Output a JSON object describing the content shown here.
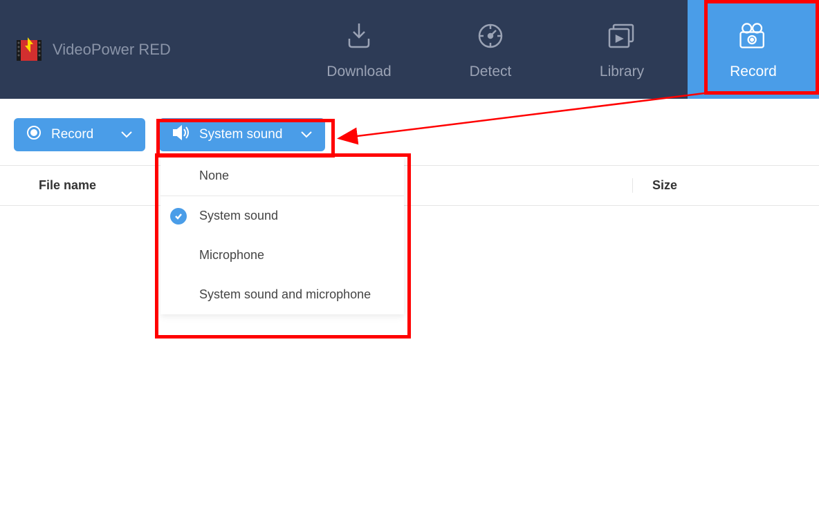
{
  "app": {
    "title": "VideoPower RED"
  },
  "nav": {
    "download": "Download",
    "detect": "Detect",
    "library": "Library",
    "record": "Record"
  },
  "toolbar": {
    "record_label": "Record",
    "sound_label": "System sound"
  },
  "table": {
    "col_filename": "File name",
    "col_size": "Size"
  },
  "dropdown": {
    "options": [
      {
        "label": "None",
        "selected": false
      },
      {
        "label": "System sound",
        "selected": true
      },
      {
        "label": "Microphone",
        "selected": false
      },
      {
        "label": "System sound and microphone",
        "selected": false
      }
    ]
  }
}
